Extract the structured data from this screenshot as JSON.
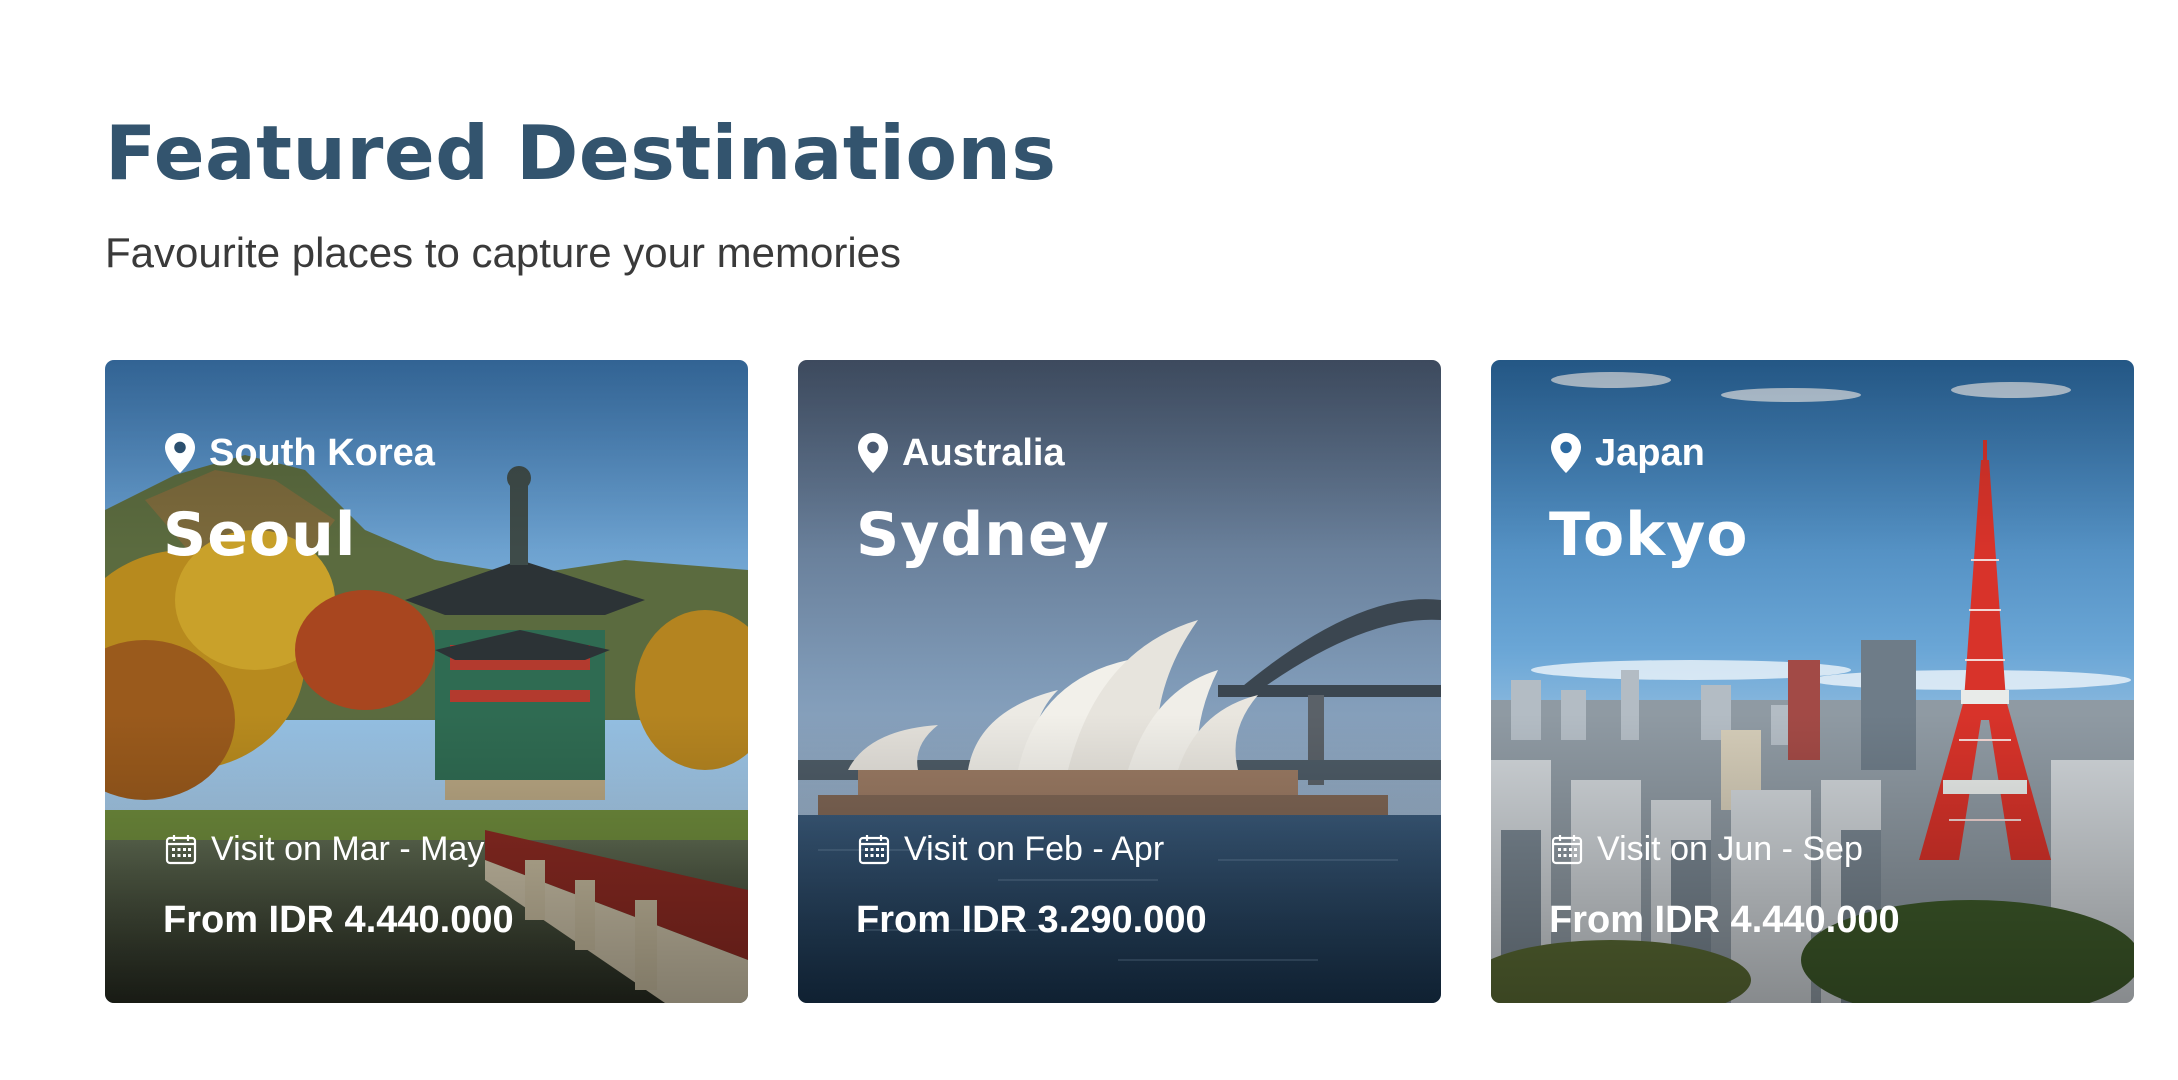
{
  "header": {
    "title": "Featured Destinations",
    "subtitle": "Favourite places to capture your memories"
  },
  "cards": [
    {
      "country": "South Korea",
      "city": "Seoul",
      "visit": "Visit on Mar - May",
      "price": "From IDR 4.440.000",
      "image": "gyeongbokgung-pavilion-photo"
    },
    {
      "country": "Australia",
      "city": "Sydney",
      "visit": "Visit on Feb - Apr",
      "price": "From IDR 3.290.000",
      "image": "sydney-opera-house-photo"
    },
    {
      "country": "Japan",
      "city": "Tokyo",
      "visit": "Visit on Jun - Sep",
      "price": "From IDR 4.440.000",
      "image": "tokyo-tower-skyline-photo"
    }
  ],
  "icons": {
    "location": "map-pin-icon",
    "date": "calendar-icon"
  },
  "colors": {
    "title": "#33546e",
    "subtitle": "#3a3a3a",
    "card_text": "#ffffff"
  }
}
